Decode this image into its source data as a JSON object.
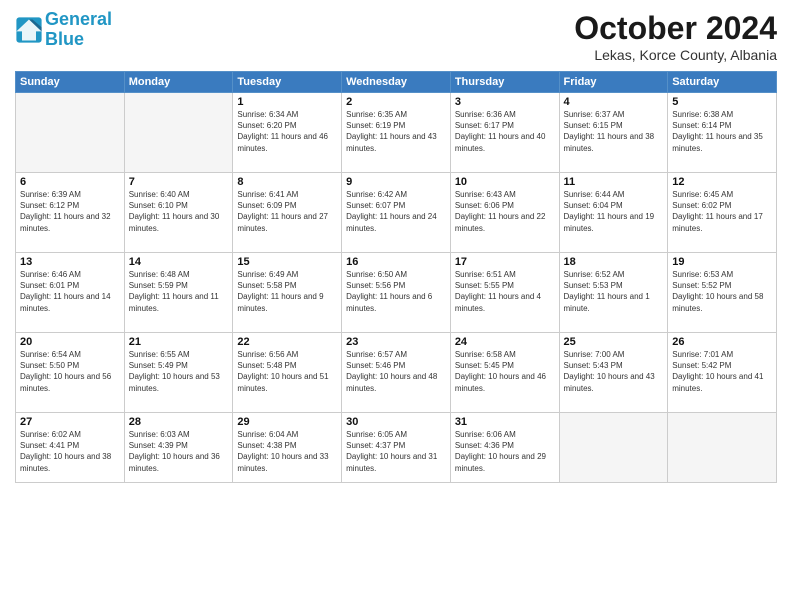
{
  "header": {
    "logo_line1": "General",
    "logo_line2": "Blue",
    "month": "October 2024",
    "location": "Lekas, Korce County, Albania"
  },
  "weekdays": [
    "Sunday",
    "Monday",
    "Tuesday",
    "Wednesday",
    "Thursday",
    "Friday",
    "Saturday"
  ],
  "weeks": [
    [
      {
        "day": "",
        "info": ""
      },
      {
        "day": "",
        "info": ""
      },
      {
        "day": "1",
        "info": "Sunrise: 6:34 AM\nSunset: 6:20 PM\nDaylight: 11 hours and 46 minutes."
      },
      {
        "day": "2",
        "info": "Sunrise: 6:35 AM\nSunset: 6:19 PM\nDaylight: 11 hours and 43 minutes."
      },
      {
        "day": "3",
        "info": "Sunrise: 6:36 AM\nSunset: 6:17 PM\nDaylight: 11 hours and 40 minutes."
      },
      {
        "day": "4",
        "info": "Sunrise: 6:37 AM\nSunset: 6:15 PM\nDaylight: 11 hours and 38 minutes."
      },
      {
        "day": "5",
        "info": "Sunrise: 6:38 AM\nSunset: 6:14 PM\nDaylight: 11 hours and 35 minutes."
      }
    ],
    [
      {
        "day": "6",
        "info": "Sunrise: 6:39 AM\nSunset: 6:12 PM\nDaylight: 11 hours and 32 minutes."
      },
      {
        "day": "7",
        "info": "Sunrise: 6:40 AM\nSunset: 6:10 PM\nDaylight: 11 hours and 30 minutes."
      },
      {
        "day": "8",
        "info": "Sunrise: 6:41 AM\nSunset: 6:09 PM\nDaylight: 11 hours and 27 minutes."
      },
      {
        "day": "9",
        "info": "Sunrise: 6:42 AM\nSunset: 6:07 PM\nDaylight: 11 hours and 24 minutes."
      },
      {
        "day": "10",
        "info": "Sunrise: 6:43 AM\nSunset: 6:06 PM\nDaylight: 11 hours and 22 minutes."
      },
      {
        "day": "11",
        "info": "Sunrise: 6:44 AM\nSunset: 6:04 PM\nDaylight: 11 hours and 19 minutes."
      },
      {
        "day": "12",
        "info": "Sunrise: 6:45 AM\nSunset: 6:02 PM\nDaylight: 11 hours and 17 minutes."
      }
    ],
    [
      {
        "day": "13",
        "info": "Sunrise: 6:46 AM\nSunset: 6:01 PM\nDaylight: 11 hours and 14 minutes."
      },
      {
        "day": "14",
        "info": "Sunrise: 6:48 AM\nSunset: 5:59 PM\nDaylight: 11 hours and 11 minutes."
      },
      {
        "day": "15",
        "info": "Sunrise: 6:49 AM\nSunset: 5:58 PM\nDaylight: 11 hours and 9 minutes."
      },
      {
        "day": "16",
        "info": "Sunrise: 6:50 AM\nSunset: 5:56 PM\nDaylight: 11 hours and 6 minutes."
      },
      {
        "day": "17",
        "info": "Sunrise: 6:51 AM\nSunset: 5:55 PM\nDaylight: 11 hours and 4 minutes."
      },
      {
        "day": "18",
        "info": "Sunrise: 6:52 AM\nSunset: 5:53 PM\nDaylight: 11 hours and 1 minute."
      },
      {
        "day": "19",
        "info": "Sunrise: 6:53 AM\nSunset: 5:52 PM\nDaylight: 10 hours and 58 minutes."
      }
    ],
    [
      {
        "day": "20",
        "info": "Sunrise: 6:54 AM\nSunset: 5:50 PM\nDaylight: 10 hours and 56 minutes."
      },
      {
        "day": "21",
        "info": "Sunrise: 6:55 AM\nSunset: 5:49 PM\nDaylight: 10 hours and 53 minutes."
      },
      {
        "day": "22",
        "info": "Sunrise: 6:56 AM\nSunset: 5:48 PM\nDaylight: 10 hours and 51 minutes."
      },
      {
        "day": "23",
        "info": "Sunrise: 6:57 AM\nSunset: 5:46 PM\nDaylight: 10 hours and 48 minutes."
      },
      {
        "day": "24",
        "info": "Sunrise: 6:58 AM\nSunset: 5:45 PM\nDaylight: 10 hours and 46 minutes."
      },
      {
        "day": "25",
        "info": "Sunrise: 7:00 AM\nSunset: 5:43 PM\nDaylight: 10 hours and 43 minutes."
      },
      {
        "day": "26",
        "info": "Sunrise: 7:01 AM\nSunset: 5:42 PM\nDaylight: 10 hours and 41 minutes."
      }
    ],
    [
      {
        "day": "27",
        "info": "Sunrise: 6:02 AM\nSunset: 4:41 PM\nDaylight: 10 hours and 38 minutes."
      },
      {
        "day": "28",
        "info": "Sunrise: 6:03 AM\nSunset: 4:39 PM\nDaylight: 10 hours and 36 minutes."
      },
      {
        "day": "29",
        "info": "Sunrise: 6:04 AM\nSunset: 4:38 PM\nDaylight: 10 hours and 33 minutes."
      },
      {
        "day": "30",
        "info": "Sunrise: 6:05 AM\nSunset: 4:37 PM\nDaylight: 10 hours and 31 minutes."
      },
      {
        "day": "31",
        "info": "Sunrise: 6:06 AM\nSunset: 4:36 PM\nDaylight: 10 hours and 29 minutes."
      },
      {
        "day": "",
        "info": ""
      },
      {
        "day": "",
        "info": ""
      }
    ]
  ]
}
